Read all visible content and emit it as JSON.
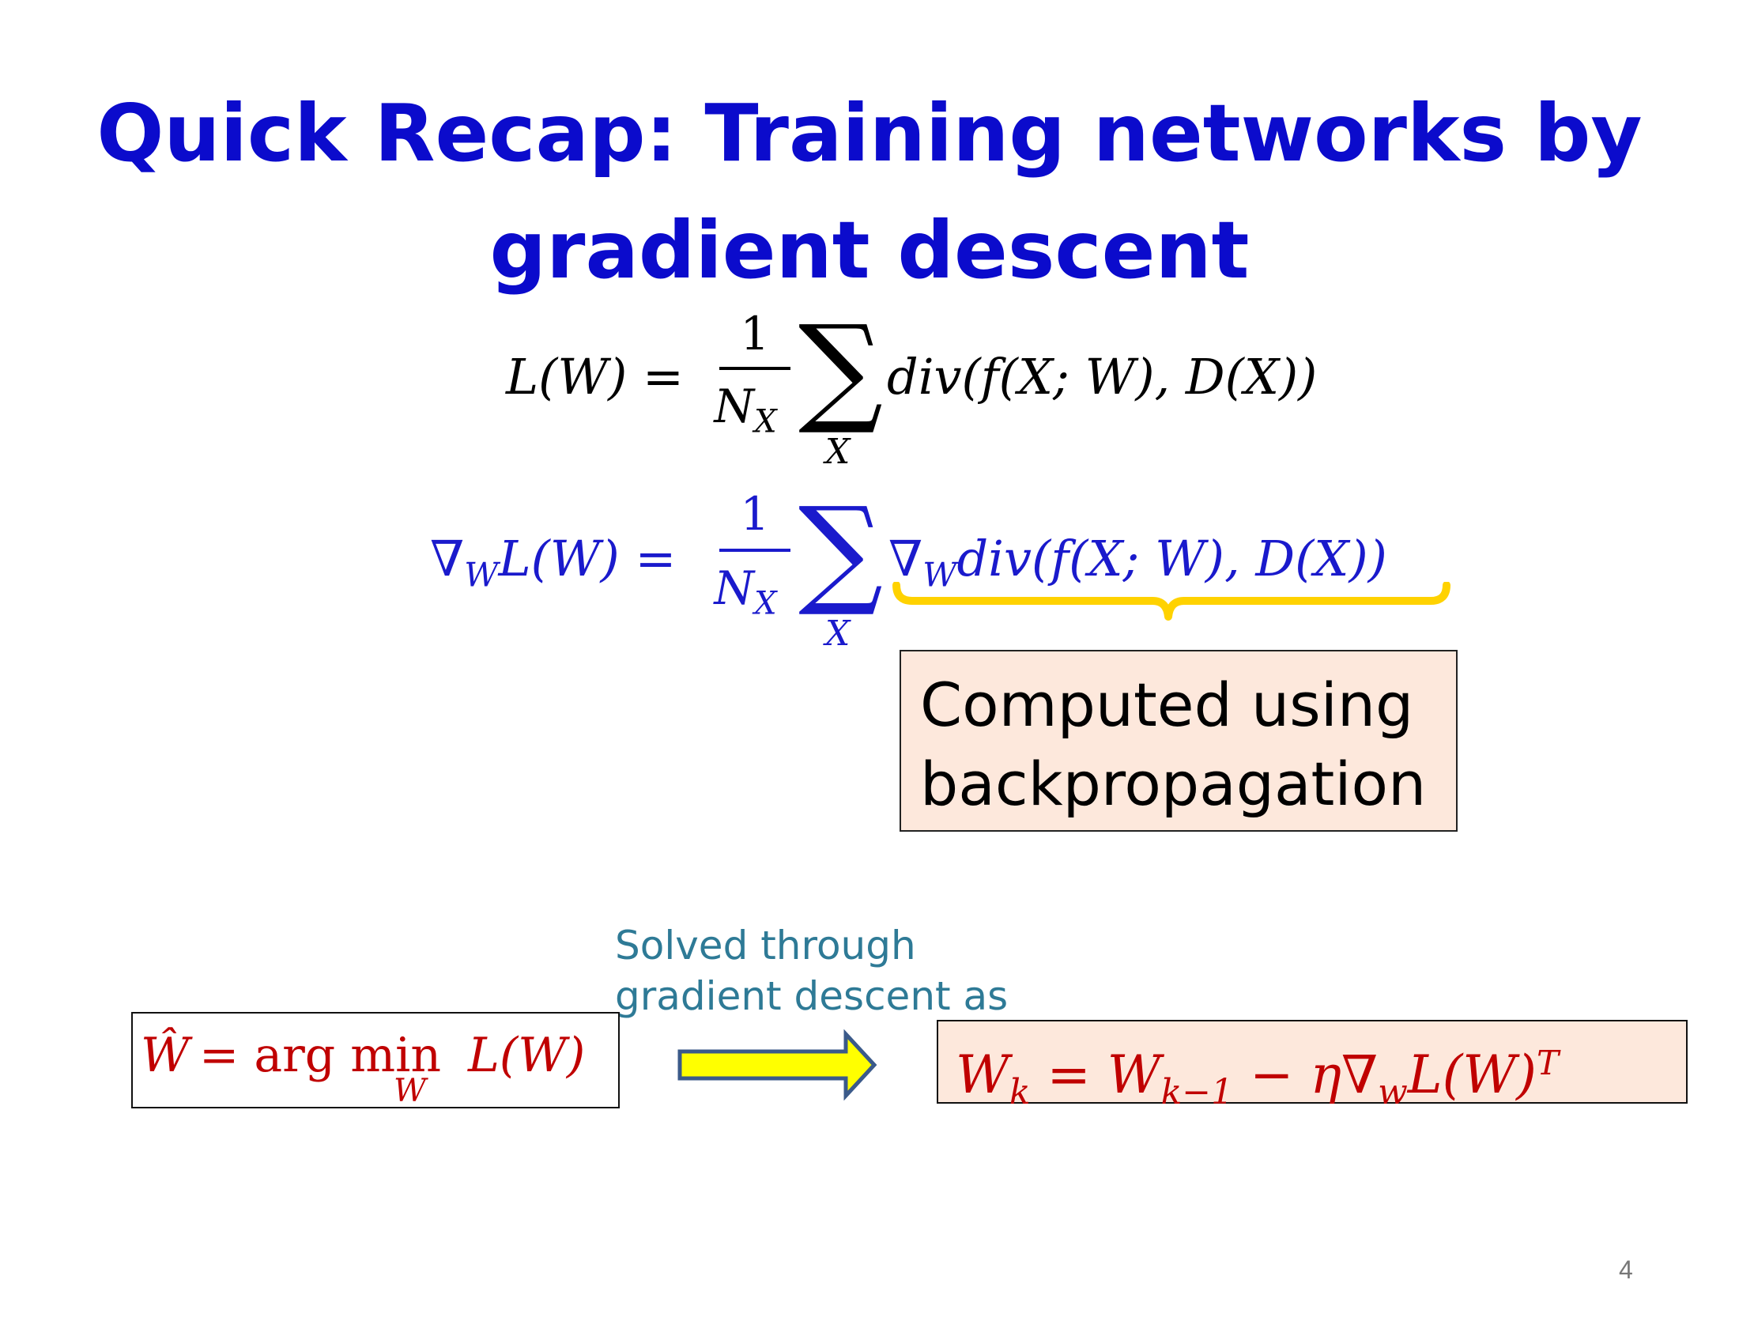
{
  "slide": {
    "title_line1": "Quick Recap: Training networks by",
    "title_line2": "gradient descent",
    "eq1": {
      "lhs": "L(W) =",
      "frac_num": "1",
      "frac_den": "N",
      "frac_den_sub": "X",
      "sigma": "∑",
      "sigma_sub": "X",
      "rhs": "div(f(X; W), D(X))"
    },
    "eq2": {
      "nabla": "∇",
      "nabla_sub": "W",
      "lhs_rest": "L(W) =",
      "frac_num": "1",
      "frac_den": "N",
      "frac_den_sub": "X",
      "sigma": "∑",
      "sigma_sub": "X",
      "rhs_nabla": "∇",
      "rhs_nabla_sub": "W",
      "rhs_rest": "div(f(X; W), D(X))"
    },
    "backprop_line1": "Computed using",
    "backprop_line2": "backpropagation",
    "solved_line1": "Solved through",
    "solved_line2": "gradient descent as",
    "argmin": {
      "what": "Ŵ",
      "op": "= arg min",
      "sub": "W",
      "rest": "L(W)"
    },
    "update": {
      "lhs": "W",
      "lhs_sub": "k",
      "eq": "=",
      "w": "W",
      "w_sub": "k−1",
      "minus": "−",
      "eta": "η",
      "nabla": "∇",
      "nabla_sub": "w",
      "rest": "L(W)",
      "sup": "T"
    },
    "page_number": "4"
  },
  "colors": {
    "title": "#0b0bcc",
    "eq_blue": "#1a1acc",
    "brace": "#ffd200",
    "note": "#2e7a96",
    "red": "#c00000",
    "box_fill": "#fde8dc",
    "arrow_fill": "#ffff00",
    "arrow_stroke": "#3b5a8a"
  }
}
